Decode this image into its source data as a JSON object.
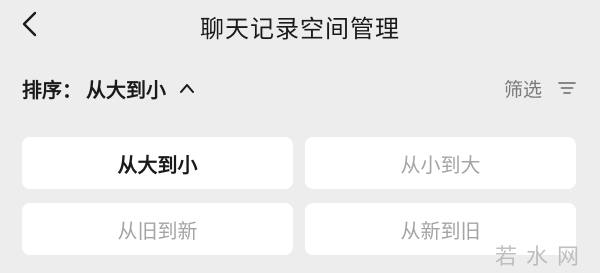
{
  "header": {
    "title": "聊天记录空间管理",
    "back_icon": "chevron-left-icon"
  },
  "sort": {
    "label": "排序：",
    "current": "从大到小",
    "expand_icon": "chevron-up-icon"
  },
  "filter": {
    "label": "筛选",
    "icon": "filter-lines-icon"
  },
  "options": [
    {
      "label": "从大到小",
      "selected": true
    },
    {
      "label": "从小到大",
      "selected": false
    },
    {
      "label": "从旧到新",
      "selected": false
    },
    {
      "label": "从新到旧",
      "selected": false
    }
  ],
  "watermark": "若水网",
  "colors": {
    "background": "#ededed",
    "card": "#ffffff",
    "text_primary": "#1a1a1a",
    "text_muted": "#a4a4a4"
  }
}
